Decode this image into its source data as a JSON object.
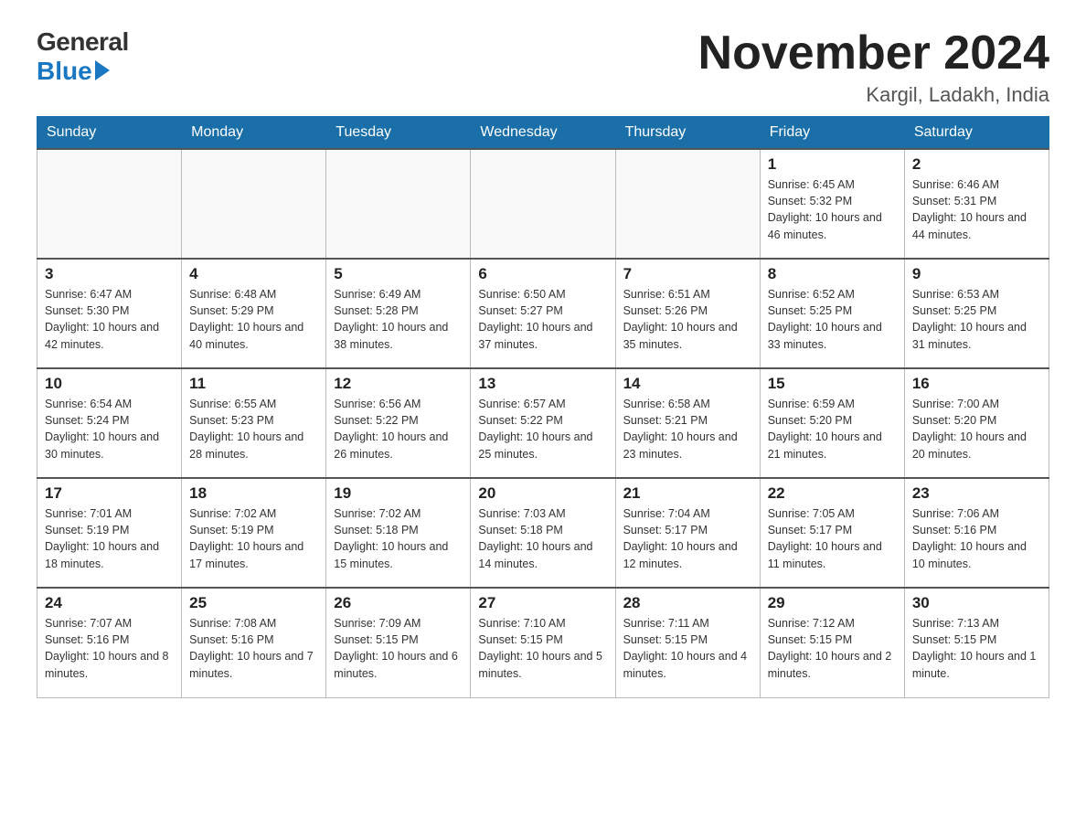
{
  "logo": {
    "general": "General",
    "blue": "Blue"
  },
  "header": {
    "month_year": "November 2024",
    "location": "Kargil, Ladakh, India"
  },
  "weekdays": [
    "Sunday",
    "Monday",
    "Tuesday",
    "Wednesday",
    "Thursday",
    "Friday",
    "Saturday"
  ],
  "weeks": [
    [
      {
        "day": "",
        "info": ""
      },
      {
        "day": "",
        "info": ""
      },
      {
        "day": "",
        "info": ""
      },
      {
        "day": "",
        "info": ""
      },
      {
        "day": "",
        "info": ""
      },
      {
        "day": "1",
        "info": "Sunrise: 6:45 AM\nSunset: 5:32 PM\nDaylight: 10 hours and 46 minutes."
      },
      {
        "day": "2",
        "info": "Sunrise: 6:46 AM\nSunset: 5:31 PM\nDaylight: 10 hours and 44 minutes."
      }
    ],
    [
      {
        "day": "3",
        "info": "Sunrise: 6:47 AM\nSunset: 5:30 PM\nDaylight: 10 hours and 42 minutes."
      },
      {
        "day": "4",
        "info": "Sunrise: 6:48 AM\nSunset: 5:29 PM\nDaylight: 10 hours and 40 minutes."
      },
      {
        "day": "5",
        "info": "Sunrise: 6:49 AM\nSunset: 5:28 PM\nDaylight: 10 hours and 38 minutes."
      },
      {
        "day": "6",
        "info": "Sunrise: 6:50 AM\nSunset: 5:27 PM\nDaylight: 10 hours and 37 minutes."
      },
      {
        "day": "7",
        "info": "Sunrise: 6:51 AM\nSunset: 5:26 PM\nDaylight: 10 hours and 35 minutes."
      },
      {
        "day": "8",
        "info": "Sunrise: 6:52 AM\nSunset: 5:25 PM\nDaylight: 10 hours and 33 minutes."
      },
      {
        "day": "9",
        "info": "Sunrise: 6:53 AM\nSunset: 5:25 PM\nDaylight: 10 hours and 31 minutes."
      }
    ],
    [
      {
        "day": "10",
        "info": "Sunrise: 6:54 AM\nSunset: 5:24 PM\nDaylight: 10 hours and 30 minutes."
      },
      {
        "day": "11",
        "info": "Sunrise: 6:55 AM\nSunset: 5:23 PM\nDaylight: 10 hours and 28 minutes."
      },
      {
        "day": "12",
        "info": "Sunrise: 6:56 AM\nSunset: 5:22 PM\nDaylight: 10 hours and 26 minutes."
      },
      {
        "day": "13",
        "info": "Sunrise: 6:57 AM\nSunset: 5:22 PM\nDaylight: 10 hours and 25 minutes."
      },
      {
        "day": "14",
        "info": "Sunrise: 6:58 AM\nSunset: 5:21 PM\nDaylight: 10 hours and 23 minutes."
      },
      {
        "day": "15",
        "info": "Sunrise: 6:59 AM\nSunset: 5:20 PM\nDaylight: 10 hours and 21 minutes."
      },
      {
        "day": "16",
        "info": "Sunrise: 7:00 AM\nSunset: 5:20 PM\nDaylight: 10 hours and 20 minutes."
      }
    ],
    [
      {
        "day": "17",
        "info": "Sunrise: 7:01 AM\nSunset: 5:19 PM\nDaylight: 10 hours and 18 minutes."
      },
      {
        "day": "18",
        "info": "Sunrise: 7:02 AM\nSunset: 5:19 PM\nDaylight: 10 hours and 17 minutes."
      },
      {
        "day": "19",
        "info": "Sunrise: 7:02 AM\nSunset: 5:18 PM\nDaylight: 10 hours and 15 minutes."
      },
      {
        "day": "20",
        "info": "Sunrise: 7:03 AM\nSunset: 5:18 PM\nDaylight: 10 hours and 14 minutes."
      },
      {
        "day": "21",
        "info": "Sunrise: 7:04 AM\nSunset: 5:17 PM\nDaylight: 10 hours and 12 minutes."
      },
      {
        "day": "22",
        "info": "Sunrise: 7:05 AM\nSunset: 5:17 PM\nDaylight: 10 hours and 11 minutes."
      },
      {
        "day": "23",
        "info": "Sunrise: 7:06 AM\nSunset: 5:16 PM\nDaylight: 10 hours and 10 minutes."
      }
    ],
    [
      {
        "day": "24",
        "info": "Sunrise: 7:07 AM\nSunset: 5:16 PM\nDaylight: 10 hours and 8 minutes."
      },
      {
        "day": "25",
        "info": "Sunrise: 7:08 AM\nSunset: 5:16 PM\nDaylight: 10 hours and 7 minutes."
      },
      {
        "day": "26",
        "info": "Sunrise: 7:09 AM\nSunset: 5:15 PM\nDaylight: 10 hours and 6 minutes."
      },
      {
        "day": "27",
        "info": "Sunrise: 7:10 AM\nSunset: 5:15 PM\nDaylight: 10 hours and 5 minutes."
      },
      {
        "day": "28",
        "info": "Sunrise: 7:11 AM\nSunset: 5:15 PM\nDaylight: 10 hours and 4 minutes."
      },
      {
        "day": "29",
        "info": "Sunrise: 7:12 AM\nSunset: 5:15 PM\nDaylight: 10 hours and 2 minutes."
      },
      {
        "day": "30",
        "info": "Sunrise: 7:13 AM\nSunset: 5:15 PM\nDaylight: 10 hours and 1 minute."
      }
    ]
  ]
}
